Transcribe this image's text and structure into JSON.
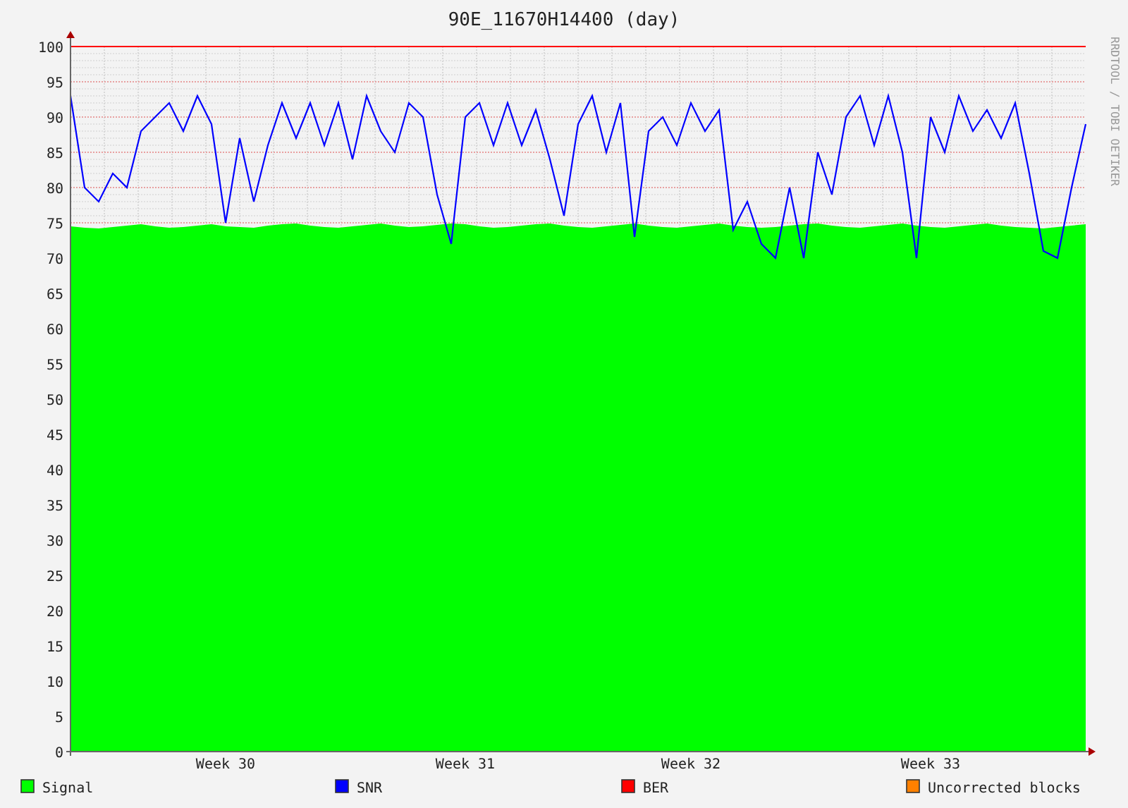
{
  "graph": {
    "title": "90E_11670H14400 (day)",
    "watermark": "RRDTOOL / TOBI OETIKER",
    "chart_data": {
      "type": "area",
      "categories": [
        null,
        null,
        null,
        null,
        null,
        null,
        null,
        null,
        null,
        null,
        null,
        "Week 30",
        null,
        null,
        null,
        null,
        null,
        null,
        null,
        null,
        null,
        null,
        null,
        null,
        null,
        null,
        null,
        null,
        "Week 31",
        null,
        null,
        null,
        null,
        null,
        null,
        null,
        null,
        null,
        null,
        null,
        null,
        null,
        null,
        null,
        "Week 32",
        null,
        null,
        null,
        null,
        null,
        null,
        null,
        null,
        null,
        null,
        null,
        null,
        null,
        null,
        null,
        null,
        "Week 33",
        null,
        null,
        null,
        null,
        null,
        null,
        null,
        null,
        null,
        null,
        null
      ],
      "ylim": [
        0,
        100
      ],
      "grid": true,
      "legend": "bottom",
      "yticks": [
        0,
        5,
        10,
        15,
        20,
        25,
        30,
        35,
        40,
        45,
        50,
        55,
        60,
        65,
        70,
        75,
        80,
        85,
        90,
        95,
        100
      ],
      "series": [
        {
          "name": "Signal",
          "color": "#00ff00",
          "values": [
            74.5,
            74.3,
            74.2,
            74.4,
            74.6,
            74.8,
            74.5,
            74.3,
            74.4,
            74.6,
            74.8,
            74.5,
            74.4,
            74.3,
            74.6,
            74.8,
            74.9,
            74.6,
            74.4,
            74.3,
            74.5,
            74.7,
            74.9,
            74.6,
            74.4,
            74.5,
            74.7,
            74.9,
            74.8,
            74.5,
            74.3,
            74.4,
            74.6,
            74.8,
            74.9,
            74.6,
            74.4,
            74.3,
            74.5,
            74.7,
            74.9,
            74.6,
            74.4,
            74.3,
            74.5,
            74.7,
            74.9,
            74.6,
            74.4,
            74.3,
            74.4,
            74.6,
            74.8,
            74.9,
            74.6,
            74.4,
            74.3,
            74.5,
            74.7,
            74.9,
            74.6,
            74.4,
            74.3,
            74.5,
            74.7,
            74.9,
            74.6,
            74.4,
            74.3,
            74.2,
            74.4,
            74.6,
            74.8
          ]
        },
        {
          "name": "SNR",
          "type": "line",
          "color": "#0000ff",
          "values": [
            93,
            80,
            78,
            82,
            80,
            88,
            90,
            92,
            88,
            93,
            89,
            75,
            87,
            78,
            86,
            92,
            87,
            92,
            86,
            92,
            84,
            93,
            88,
            85,
            92,
            90,
            79,
            72,
            90,
            92,
            86,
            92,
            86,
            91,
            84,
            76,
            89,
            93,
            85,
            92,
            73,
            88,
            90,
            86,
            92,
            88,
            91,
            74,
            78,
            72,
            70,
            80,
            70,
            85,
            79,
            90,
            93,
            86,
            93,
            85,
            70,
            90,
            85,
            93,
            88,
            91,
            87,
            92,
            82,
            71,
            70,
            80,
            89
          ]
        },
        {
          "name": "BER",
          "type": "line",
          "color": "#ff0000",
          "values": [
            100,
            100,
            100,
            100,
            100,
            100,
            100,
            100,
            100,
            100,
            100,
            100,
            100,
            100,
            100,
            100,
            100,
            100,
            100,
            100,
            100,
            100,
            100,
            100,
            100,
            100,
            100,
            100,
            100,
            100,
            100,
            100,
            100,
            100,
            100,
            100,
            100,
            100,
            100,
            100,
            100,
            100,
            100,
            100,
            100,
            100,
            100,
            100,
            100,
            100,
            100,
            100,
            100,
            100,
            100,
            100,
            100,
            100,
            100,
            100,
            100,
            100,
            100,
            100,
            100,
            100,
            100,
            100,
            100,
            100,
            100,
            100,
            100
          ]
        },
        {
          "name": "Uncorrected blocks",
          "type": "line",
          "color": "#ff8000",
          "values": [
            null,
            null,
            null,
            null,
            null,
            null,
            null,
            null,
            null,
            null,
            null,
            null,
            null,
            null,
            null,
            null,
            null,
            null,
            null,
            null,
            null,
            null,
            null,
            null,
            null,
            null,
            null,
            null,
            null,
            null,
            null,
            null,
            null,
            null,
            null,
            null,
            null,
            null,
            null,
            null,
            null,
            null,
            null,
            null,
            null,
            null,
            null,
            null,
            null,
            null,
            null,
            null,
            null,
            null,
            null,
            null,
            null,
            null,
            null,
            null,
            null,
            null,
            null,
            null,
            null,
            null,
            null,
            null,
            null,
            null,
            null,
            null,
            null
          ]
        }
      ]
    }
  }
}
